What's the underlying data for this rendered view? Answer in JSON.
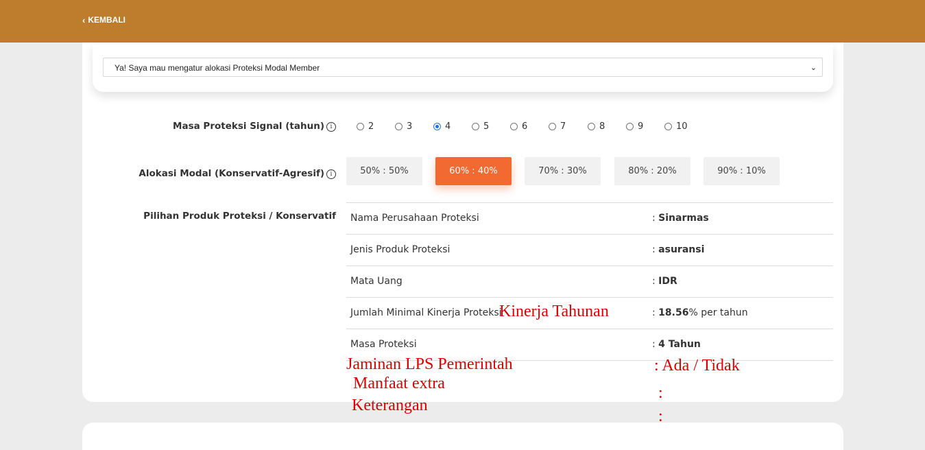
{
  "header": {
    "back_label": "KEMBALI",
    "back_icon": "chevron-left-icon"
  },
  "select": {
    "value": "Ya! Saya mau mengatur alokasi Proteksi Modal Member"
  },
  "masa_proteksi": {
    "label": "Masa Proteksi Signal (tahun)",
    "options": [
      "2",
      "3",
      "4",
      "5",
      "6",
      "7",
      "8",
      "9",
      "10"
    ],
    "selected": "4"
  },
  "alokasi": {
    "label": "Alokasi Modal (Konservatif-Agresif)",
    "options": [
      "50% : 50%",
      "60% : 40%",
      "70% : 30%",
      "80% : 20%",
      "90% : 10%"
    ],
    "selected": "60% : 40%"
  },
  "produk": {
    "label": "Pilihan Produk Proteksi / Konservatif",
    "rows": [
      {
        "key": "Nama Perusahaan Proteksi",
        "prefix": ": ",
        "bold": "Sinarmas",
        "suffix": ""
      },
      {
        "key": "Jenis Produk Proteksi",
        "prefix": ": ",
        "bold": "asuransi",
        "suffix": ""
      },
      {
        "key": "Mata Uang",
        "prefix": ": ",
        "bold": "IDR",
        "suffix": ""
      },
      {
        "key": "Jumlah Minimal Kinerja Proteksi",
        "prefix": ": ",
        "bold": "18.56",
        "suffix": "% per tahun"
      },
      {
        "key": "Masa Proteksi",
        "prefix": ": ",
        "bold": "4 Tahun",
        "suffix": ""
      }
    ]
  },
  "annotations": {
    "kinerja": "Kinerja Tahunan",
    "jaminan": "Jaminan LPS Pemerintah",
    "manfaat": "Manfaat extra",
    "keterangan": "Keterangan",
    "ada_tidak": ": Ada / Tidak",
    "colon1": ":",
    "colon2": ":"
  },
  "colors": {
    "header": "#bd7d2c",
    "accent": "#f26a32",
    "annotation": "#e00000",
    "radio": "#1a73e8"
  }
}
